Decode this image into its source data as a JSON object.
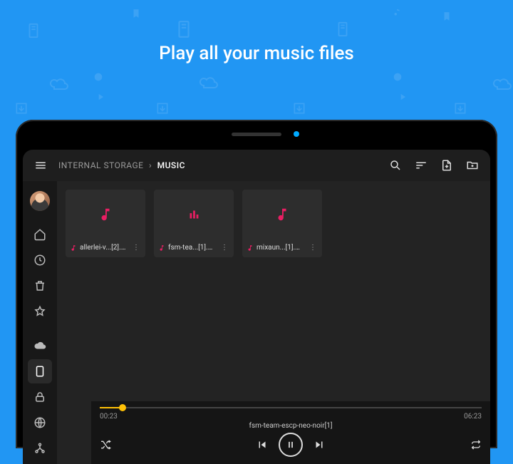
{
  "headline": "Play all your music files",
  "breadcrumb": {
    "root": "INTERNAL STORAGE",
    "current": "MUSIC"
  },
  "topbar_icons": {
    "menu": "menu-icon",
    "search": "search-icon",
    "sort": "sort-icon",
    "newfile": "new-file-icon",
    "newfolder": "new-folder-icon"
  },
  "sidebar": [
    {
      "name": "home-icon"
    },
    {
      "name": "recent-icon"
    },
    {
      "name": "trash-icon"
    },
    {
      "name": "favorites-icon"
    },
    {
      "name": "cloud-icon"
    },
    {
      "name": "device-icon",
      "active": true
    },
    {
      "name": "lock-icon"
    },
    {
      "name": "globe-icon"
    },
    {
      "name": "network-icon"
    }
  ],
  "files": [
    {
      "name": "allerlei-v...[2].mp3",
      "playing": false
    },
    {
      "name": "fsm-tea...[1].mp3",
      "playing": true
    },
    {
      "name": "mixaun...[1].mp3",
      "playing": false
    }
  ],
  "player": {
    "track": "fsm-team-escp-neo-noir[1]",
    "elapsed": "00:23",
    "total": "06:23",
    "progress_pct": 6,
    "shuffle": false,
    "repeat": false
  },
  "colors": {
    "accent": "#e91e63",
    "progress": "#ffc107",
    "bg": "#2196f3"
  }
}
